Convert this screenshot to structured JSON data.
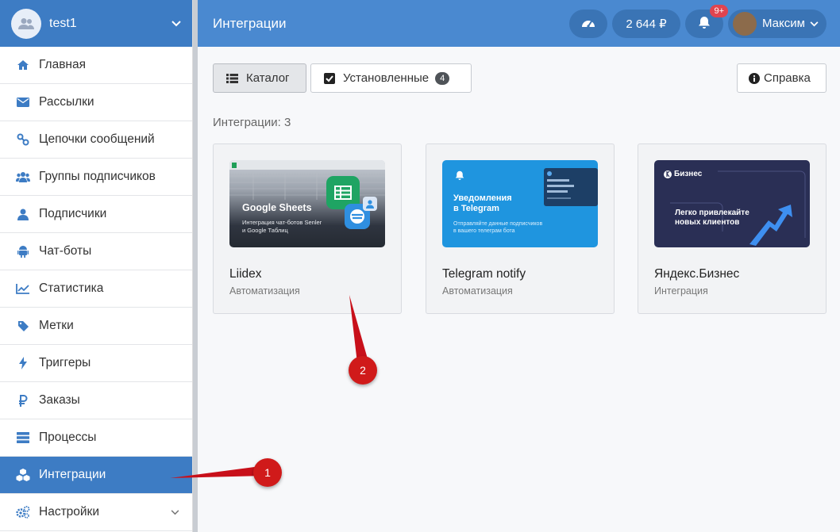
{
  "account": {
    "name": "test1"
  },
  "sidebar": {
    "items": [
      {
        "label": "Главная",
        "icon": "home-icon"
      },
      {
        "label": "Рассылки",
        "icon": "envelope-icon"
      },
      {
        "label": "Цепочки сообщений",
        "icon": "chain-icon"
      },
      {
        "label": "Группы подписчиков",
        "icon": "users-icon"
      },
      {
        "label": "Подписчики",
        "icon": "user-icon"
      },
      {
        "label": "Чат-боты",
        "icon": "android-icon"
      },
      {
        "label": "Статистика",
        "icon": "chart-icon"
      },
      {
        "label": "Метки",
        "icon": "tag-icon"
      },
      {
        "label": "Триггеры",
        "icon": "bolt-icon"
      },
      {
        "label": "Заказы",
        "icon": "ruble-icon"
      },
      {
        "label": "Процессы",
        "icon": "server-icon"
      },
      {
        "label": "Интеграции",
        "icon": "cubes-icon"
      },
      {
        "label": "Настройки",
        "icon": "cogs-icon"
      }
    ]
  },
  "header": {
    "title": "Интеграции",
    "balance": "2 644 ₽",
    "notifications": "9+",
    "user": "Максим"
  },
  "toolbar": {
    "catalog_label": "Каталог",
    "installed_label": "Установленные",
    "installed_count": "4",
    "help_label": "Справка"
  },
  "main": {
    "count_label": "Интеграции: 3",
    "cards": [
      {
        "name": "Liidex",
        "category": "Автоматизация",
        "banner_title": "Google Sheets",
        "banner_sub1": "Интеграция чат-ботов Senler",
        "banner_sub2": "и Google Таблиц"
      },
      {
        "name": "Telegram notify",
        "category": "Автоматизация",
        "banner_title1": "Уведомления",
        "banner_title2": "в Telegram",
        "banner_sub1": "Отправляйте данные подписчиков",
        "banner_sub2": "в вашего телеграм бота"
      },
      {
        "name": "Яндекс.Бизнес",
        "category": "Интеграция",
        "banner_brand": "Бизнес",
        "banner_title1": "Легко привлекайте",
        "banner_title2": "новых клиентов"
      }
    ]
  },
  "annotations": {
    "marker1": "1",
    "marker2": "2"
  },
  "colors": {
    "accent": "#3d7cc4",
    "header": "#4a89d0",
    "marker": "#d01a1a"
  }
}
